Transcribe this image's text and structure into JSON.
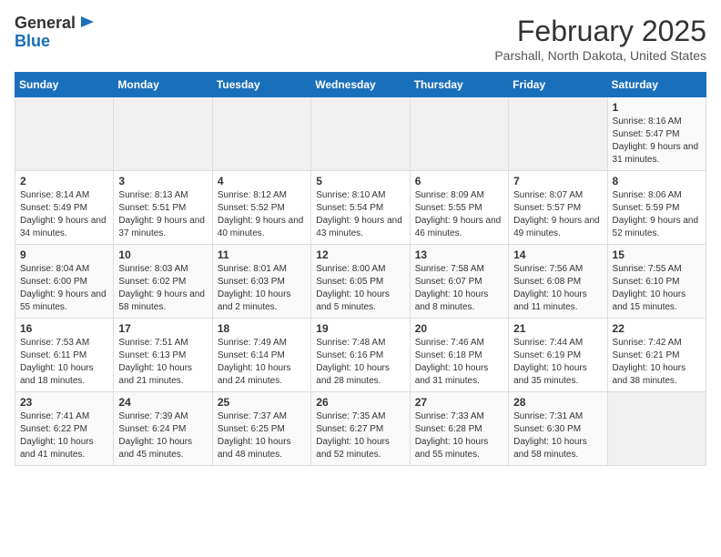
{
  "header": {
    "logo_general": "General",
    "logo_blue": "Blue",
    "month": "February 2025",
    "location": "Parshall, North Dakota, United States"
  },
  "weekdays": [
    "Sunday",
    "Monday",
    "Tuesday",
    "Wednesday",
    "Thursday",
    "Friday",
    "Saturday"
  ],
  "weeks": [
    [
      {
        "day": "",
        "info": ""
      },
      {
        "day": "",
        "info": ""
      },
      {
        "day": "",
        "info": ""
      },
      {
        "day": "",
        "info": ""
      },
      {
        "day": "",
        "info": ""
      },
      {
        "day": "",
        "info": ""
      },
      {
        "day": "1",
        "info": "Sunrise: 8:16 AM\nSunset: 5:47 PM\nDaylight: 9 hours and 31 minutes."
      }
    ],
    [
      {
        "day": "2",
        "info": "Sunrise: 8:14 AM\nSunset: 5:49 PM\nDaylight: 9 hours and 34 minutes."
      },
      {
        "day": "3",
        "info": "Sunrise: 8:13 AM\nSunset: 5:51 PM\nDaylight: 9 hours and 37 minutes."
      },
      {
        "day": "4",
        "info": "Sunrise: 8:12 AM\nSunset: 5:52 PM\nDaylight: 9 hours and 40 minutes."
      },
      {
        "day": "5",
        "info": "Sunrise: 8:10 AM\nSunset: 5:54 PM\nDaylight: 9 hours and 43 minutes."
      },
      {
        "day": "6",
        "info": "Sunrise: 8:09 AM\nSunset: 5:55 PM\nDaylight: 9 hours and 46 minutes."
      },
      {
        "day": "7",
        "info": "Sunrise: 8:07 AM\nSunset: 5:57 PM\nDaylight: 9 hours and 49 minutes."
      },
      {
        "day": "8",
        "info": "Sunrise: 8:06 AM\nSunset: 5:59 PM\nDaylight: 9 hours and 52 minutes."
      }
    ],
    [
      {
        "day": "9",
        "info": "Sunrise: 8:04 AM\nSunset: 6:00 PM\nDaylight: 9 hours and 55 minutes."
      },
      {
        "day": "10",
        "info": "Sunrise: 8:03 AM\nSunset: 6:02 PM\nDaylight: 9 hours and 58 minutes."
      },
      {
        "day": "11",
        "info": "Sunrise: 8:01 AM\nSunset: 6:03 PM\nDaylight: 10 hours and 2 minutes."
      },
      {
        "day": "12",
        "info": "Sunrise: 8:00 AM\nSunset: 6:05 PM\nDaylight: 10 hours and 5 minutes."
      },
      {
        "day": "13",
        "info": "Sunrise: 7:58 AM\nSunset: 6:07 PM\nDaylight: 10 hours and 8 minutes."
      },
      {
        "day": "14",
        "info": "Sunrise: 7:56 AM\nSunset: 6:08 PM\nDaylight: 10 hours and 11 minutes."
      },
      {
        "day": "15",
        "info": "Sunrise: 7:55 AM\nSunset: 6:10 PM\nDaylight: 10 hours and 15 minutes."
      }
    ],
    [
      {
        "day": "16",
        "info": "Sunrise: 7:53 AM\nSunset: 6:11 PM\nDaylight: 10 hours and 18 minutes."
      },
      {
        "day": "17",
        "info": "Sunrise: 7:51 AM\nSunset: 6:13 PM\nDaylight: 10 hours and 21 minutes."
      },
      {
        "day": "18",
        "info": "Sunrise: 7:49 AM\nSunset: 6:14 PM\nDaylight: 10 hours and 24 minutes."
      },
      {
        "day": "19",
        "info": "Sunrise: 7:48 AM\nSunset: 6:16 PM\nDaylight: 10 hours and 28 minutes."
      },
      {
        "day": "20",
        "info": "Sunrise: 7:46 AM\nSunset: 6:18 PM\nDaylight: 10 hours and 31 minutes."
      },
      {
        "day": "21",
        "info": "Sunrise: 7:44 AM\nSunset: 6:19 PM\nDaylight: 10 hours and 35 minutes."
      },
      {
        "day": "22",
        "info": "Sunrise: 7:42 AM\nSunset: 6:21 PM\nDaylight: 10 hours and 38 minutes."
      }
    ],
    [
      {
        "day": "23",
        "info": "Sunrise: 7:41 AM\nSunset: 6:22 PM\nDaylight: 10 hours and 41 minutes."
      },
      {
        "day": "24",
        "info": "Sunrise: 7:39 AM\nSunset: 6:24 PM\nDaylight: 10 hours and 45 minutes."
      },
      {
        "day": "25",
        "info": "Sunrise: 7:37 AM\nSunset: 6:25 PM\nDaylight: 10 hours and 48 minutes."
      },
      {
        "day": "26",
        "info": "Sunrise: 7:35 AM\nSunset: 6:27 PM\nDaylight: 10 hours and 52 minutes."
      },
      {
        "day": "27",
        "info": "Sunrise: 7:33 AM\nSunset: 6:28 PM\nDaylight: 10 hours and 55 minutes."
      },
      {
        "day": "28",
        "info": "Sunrise: 7:31 AM\nSunset: 6:30 PM\nDaylight: 10 hours and 58 minutes."
      },
      {
        "day": "",
        "info": ""
      }
    ]
  ]
}
